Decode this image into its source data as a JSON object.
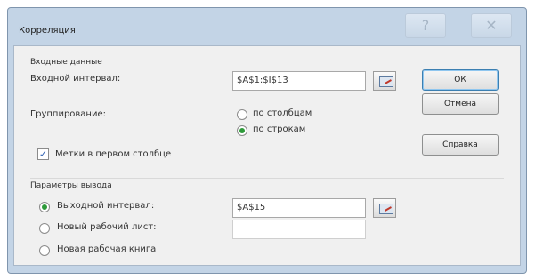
{
  "window": {
    "title": "Корреляция",
    "help_glyph": "?",
    "close_glyph": "✕"
  },
  "input_section": {
    "heading": "Входные данные",
    "input_range_label": "Входной интервал:",
    "input_range_value": "$A$1:$I$13",
    "grouping_label": "Группирование:",
    "grouping_options": [
      "по столбцам",
      "по строкам"
    ],
    "grouping_selected": "по строкам",
    "labels_checkbox_label": "Метки в первом столбце",
    "labels_checkbox_checked": true
  },
  "output_section": {
    "heading": "Параметры вывода",
    "options": [
      "Выходной интервал:",
      "Новый рабочий лист:",
      "Новая рабочая книга"
    ],
    "selected": "Выходной интервал:",
    "output_range_value": "$A$15",
    "new_sheet_value": ""
  },
  "buttons": {
    "ok": "ОК",
    "cancel": "Отмена",
    "help": "Справка"
  },
  "icons": {
    "ref_button": "collapse-dialog-icon"
  }
}
